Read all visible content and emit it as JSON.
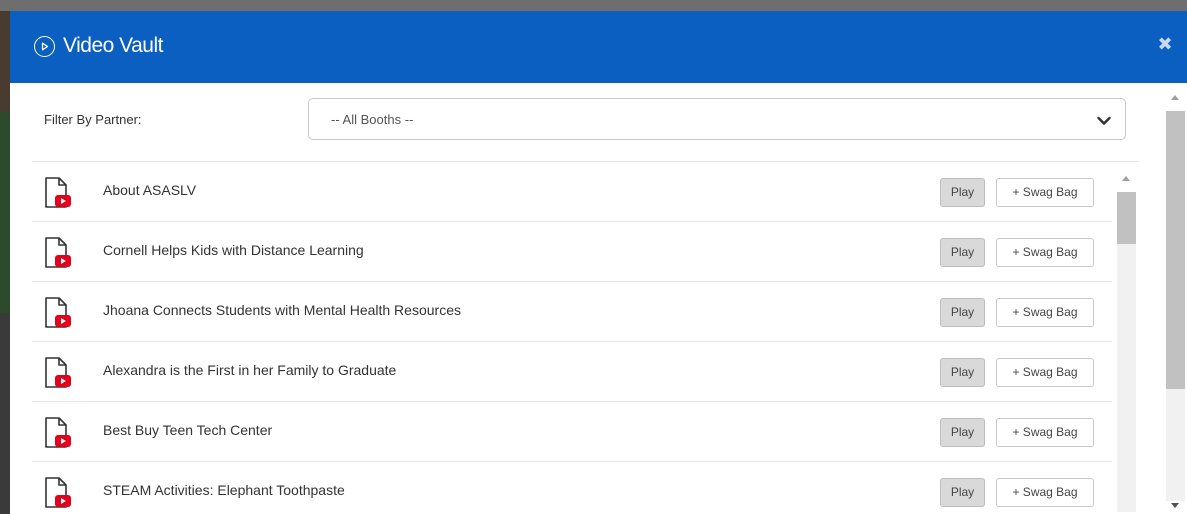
{
  "modal": {
    "title": "Video Vault",
    "header_color": "#0b5fc1",
    "close_icon": "close-icon"
  },
  "filter": {
    "label": "Filter By Partner:",
    "selected": "-- All Booths --"
  },
  "video_list": [
    {
      "title": "About ASASLV",
      "play_label": "Play",
      "swag_label": "+ Swag Bag"
    },
    {
      "title": "Cornell Helps Kids with Distance Learning",
      "play_label": "Play",
      "swag_label": "+ Swag Bag"
    },
    {
      "title": "Jhoana Connects Students with Mental Health Resources",
      "play_label": "Play",
      "swag_label": "+ Swag Bag"
    },
    {
      "title": "Alexandra is the First in her Family to Graduate",
      "play_label": "Play",
      "swag_label": "+ Swag Bag"
    },
    {
      "title": "Best Buy Teen Tech Center",
      "play_label": "Play",
      "swag_label": "+ Swag Bag"
    },
    {
      "title": "STEAM Activities: Elephant Toothpaste",
      "play_label": "Play",
      "swag_label": "+ Swag Bag"
    }
  ],
  "icons": {
    "header": "play-circle-icon",
    "row": "video-file-icon",
    "select": "chevron-down-icon"
  }
}
